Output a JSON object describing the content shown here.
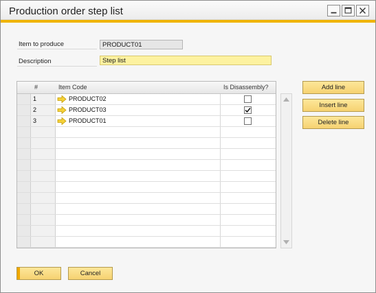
{
  "window": {
    "title": "Production order step list",
    "accent_color": "#f0b400"
  },
  "fields": {
    "item_to_produce": {
      "label": "Item to produce",
      "value": "PRODUCT01"
    },
    "description": {
      "label": "Description",
      "value": "Step list"
    }
  },
  "grid": {
    "columns": [
      "#",
      "Item Code",
      "Is Disassembly?"
    ],
    "rows": [
      {
        "num": "1",
        "item_code": "PRODUCT02",
        "is_disassembly": false
      },
      {
        "num": "2",
        "item_code": "PRODUCT03",
        "is_disassembly": true
      },
      {
        "num": "3",
        "item_code": "PRODUCT01",
        "is_disassembly": false
      }
    ],
    "empty_rows": 12,
    "link_icon": "yellow-arrow-icon"
  },
  "actions": {
    "add_line": "Add line",
    "insert_line": "Insert line",
    "delete_line": "Delete line"
  },
  "footer": {
    "ok": "OK",
    "cancel": "Cancel"
  }
}
